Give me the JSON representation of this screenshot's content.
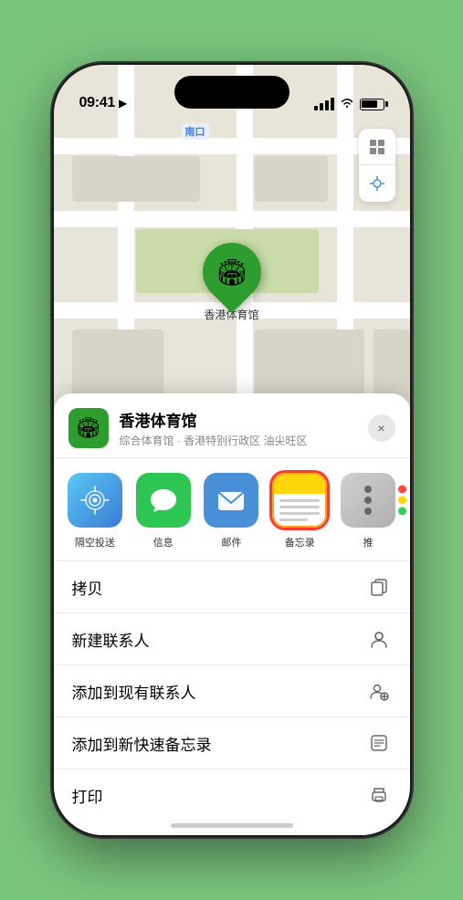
{
  "status_bar": {
    "time": "09:41",
    "location_arrow": "▶"
  },
  "map": {
    "label_text": "南口",
    "venue_name_on_map": "香港体育馆",
    "pin_emoji": "🏟"
  },
  "sheet": {
    "venue_name": "香港体育馆",
    "venue_subtitle": "综合体育馆 · 香港特别行政区 油尖旺区",
    "venue_emoji": "🏟",
    "close_label": "×"
  },
  "share_items": [
    {
      "id": "airdrop",
      "label": "隔空投送",
      "icon": "📡"
    },
    {
      "id": "messages",
      "label": "信息",
      "icon": "💬"
    },
    {
      "id": "mail",
      "label": "邮件",
      "icon": "✉️"
    },
    {
      "id": "notes",
      "label": "备忘录",
      "icon": ""
    },
    {
      "id": "more",
      "label": "推",
      "icon": "···"
    }
  ],
  "actions": [
    {
      "id": "copy",
      "label": "拷贝",
      "icon": "⎘"
    },
    {
      "id": "new-contact",
      "label": "新建联系人",
      "icon": "👤"
    },
    {
      "id": "add-existing",
      "label": "添加到现有联系人",
      "icon": "👥"
    },
    {
      "id": "quick-note",
      "label": "添加到新快速备忘录",
      "icon": "📝"
    },
    {
      "id": "print",
      "label": "打印",
      "icon": "🖨"
    }
  ]
}
